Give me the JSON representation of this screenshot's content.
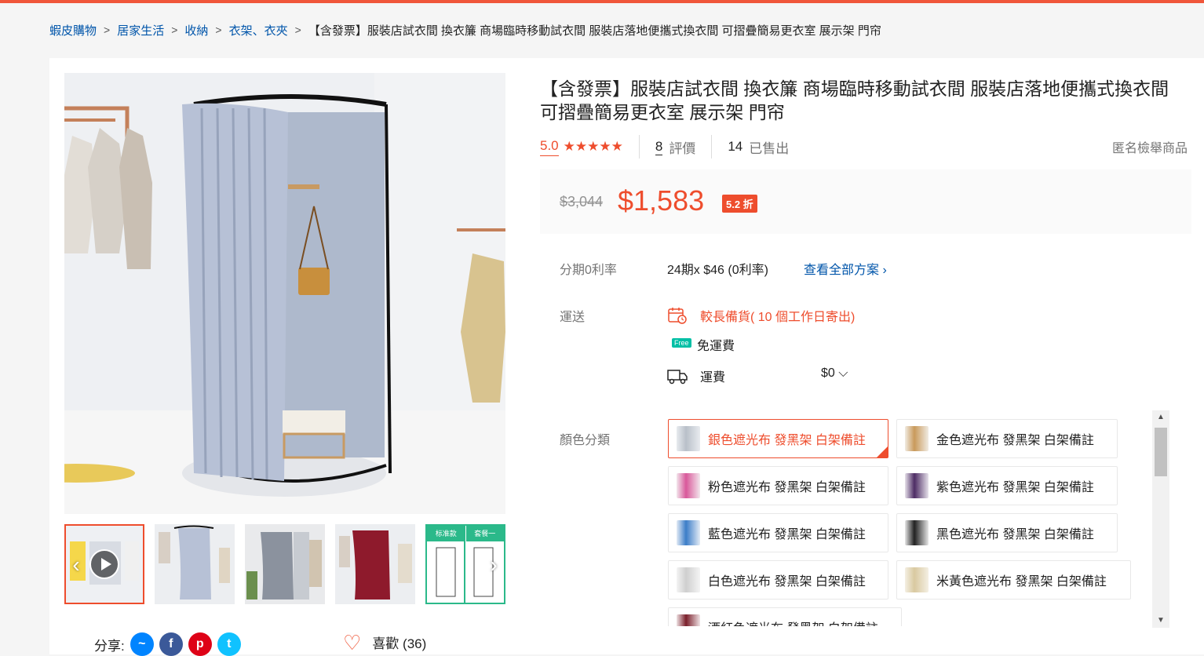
{
  "breadcrumb": {
    "items": [
      "蝦皮購物",
      "居家生活",
      "收納",
      "衣架、衣夾"
    ],
    "separator": ">",
    "current": "【含發票】服裝店試衣間 換衣簾 商場臨時移動試衣間 服裝店落地便攜式換衣間 可摺疊簡易更衣室 展示架 門帘"
  },
  "product": {
    "title": "【含發票】服裝店試衣間 換衣簾 商場臨時移動試衣間 服裝店落地便攜式換衣間 可摺疊簡易更衣室 展示架 門帘",
    "rating": "5.0",
    "stars": "★★★★★",
    "review_count": "8",
    "review_label": "評價",
    "sold_count": "14",
    "sold_label": "已售出",
    "report_label": "匿名檢舉商品"
  },
  "price": {
    "original": "$3,044",
    "current": "$1,583",
    "discount": "5.2 折"
  },
  "installment": {
    "label": "分期0利率",
    "value": "24期x $46 (0利率)",
    "link": "查看全部方案 ›"
  },
  "shipping": {
    "label": "運送",
    "prep_note": "較長備貨( 10 個工作日寄出)",
    "free_badge": "Free",
    "free_label": "免運費",
    "fee_label": "運費",
    "fee_value": "$0 ⌵"
  },
  "variants": {
    "label": "顏色分類",
    "options": [
      {
        "label": "銀色遮光布 發黑架 白架備註",
        "color": "#b9c0c9",
        "selected": true
      },
      {
        "label": "金色遮光布 發黑架 白架備註",
        "color": "#c99a5b",
        "selected": false
      },
      {
        "label": "粉色遮光布 發黑架 白架備註",
        "color": "#d9589a",
        "selected": false
      },
      {
        "label": "紫色遮光布 發黑架 白架備註",
        "color": "#4d2c64",
        "selected": false
      },
      {
        "label": "藍色遮光布 發黑架 白架備註",
        "color": "#3b7dc8",
        "selected": false
      },
      {
        "label": "黑色遮光布 發黑架 白架備註",
        "color": "#222222",
        "selected": false
      },
      {
        "label": "白色遮光布 發黑架 白架備註",
        "color": "#e8e8e8",
        "selected": false
      },
      {
        "label": "米黃色遮光布 發黑架 白架備註",
        "color": "#d9c9a0",
        "selected": false
      },
      {
        "label": "酒紅色遮光布 發黑架 白架備註",
        "color": "#7a1f2b",
        "selected": false
      }
    ]
  },
  "gallery": {
    "thumb_labels": [
      "标准款",
      "套餐一"
    ]
  },
  "social": {
    "share_label": "分享:",
    "like_label": "喜歡 (36)"
  },
  "colors": {
    "accent": "#ee4d2d",
    "link": "#0055aa",
    "topbar": "#f0563a"
  }
}
